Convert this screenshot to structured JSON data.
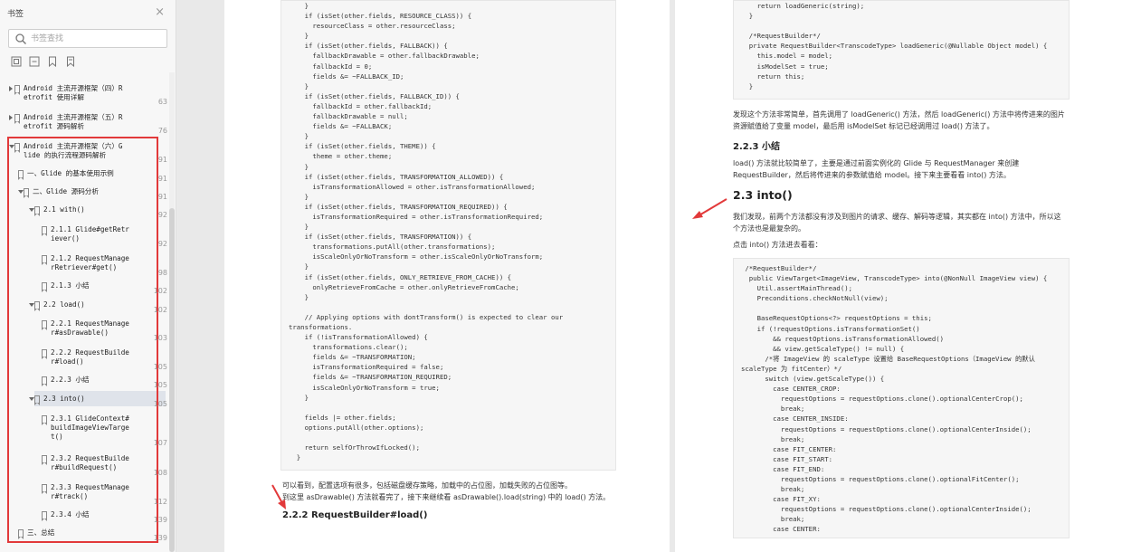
{
  "sidebar": {
    "title": "书签",
    "search_placeholder": "书签查找",
    "items": [
      {
        "label": "Android 主流开源框架（四）R\netrofit 使用详解",
        "page": "63"
      },
      {
        "label": "Android 主流开源框架（五）R\netrofit 源码解析",
        "page": "76"
      },
      {
        "label": "Android 主流开源框架（六）G\nlide 的执行流程源码解析",
        "page": "91"
      },
      {
        "label": "一、Glide 的基本使用示例",
        "page": "91"
      },
      {
        "label": "二、Glide 源码分析",
        "page": "91"
      },
      {
        "label": "2.1 with()",
        "page": "92"
      },
      {
        "label": "2.1.1 Glide#getRetr\niever()",
        "page": "92"
      },
      {
        "label": "2.1.2 RequestManage\nrRetriever#get()",
        "page": "98"
      },
      {
        "label": "2.1.3 小结",
        "page": "102"
      },
      {
        "label": "2.2 load()",
        "page": "102"
      },
      {
        "label": "2.2.1 RequestManage\nr#asDrawable()",
        "page": "103"
      },
      {
        "label": "2.2.2 RequestBuilde\nr#load()",
        "page": "105"
      },
      {
        "label": "2.2.3 小结",
        "page": "105"
      },
      {
        "label": "2.3 into()",
        "page": "105"
      },
      {
        "label": "2.3.1 GlideContext#\nbuildImageViewTarge\nt()",
        "page": "107"
      },
      {
        "label": "2.3.2 RequestBuilde\nr#buildRequest()",
        "page": "108"
      },
      {
        "label": "2.3.3 RequestManage\nr#track()",
        "page": "112"
      },
      {
        "label": "2.3.4 小结",
        "page": "139"
      },
      {
        "label": "三、总结",
        "page": "139"
      }
    ]
  },
  "left_page": {
    "code": "    }\n    if (isSet(other.fields, RESOURCE_CLASS)) {\n      resourceClass = other.resourceClass;\n    }\n    if (isSet(other.fields, FALLBACK)) {\n      fallbackDrawable = other.fallbackDrawable;\n      fallbackId = 0;\n      fields &= ~FALLBACK_ID;\n    }\n    if (isSet(other.fields, FALLBACK_ID)) {\n      fallbackId = other.fallbackId;\n      fallbackDrawable = null;\n      fields &= ~FALLBACK;\n    }\n    if (isSet(other.fields, THEME)) {\n      theme = other.theme;\n    }\n    if (isSet(other.fields, TRANSFORMATION_ALLOWED)) {\n      isTransformationAllowed = other.isTransformationAllowed;\n    }\n    if (isSet(other.fields, TRANSFORMATION_REQUIRED)) {\n      isTransformationRequired = other.isTransformationRequired;\n    }\n    if (isSet(other.fields, TRANSFORMATION)) {\n      transformations.putAll(other.transformations);\n      isScaleOnlyOrNoTransform = other.isScaleOnlyOrNoTransform;\n    }\n    if (isSet(other.fields, ONLY_RETRIEVE_FROM_CACHE)) {\n      onlyRetrieveFromCache = other.onlyRetrieveFromCache;\n    }\n\n    // Applying options with dontTransform() is expected to clear our\ntransformations.\n    if (!isTransformationAllowed) {\n      transformations.clear();\n      fields &= ~TRANSFORMATION;\n      isTransformationRequired = false;\n      fields &= ~TRANSFORMATION_REQUIRED;\n      isScaleOnlyOrNoTransform = true;\n    }\n\n    fields |= other.fields;\n    options.putAll(other.options);\n\n    return selfOrThrowIfLocked();\n  }",
    "para1": "可以看到，配置选项有很多，包括磁盘缓存策略，加载中的占位图，加载失败的占位图等。",
    "para2": "到这里 asDrawable() 方法就看完了，接下来继续看 asDrawable().load(string) 中的 load() 方法。",
    "heading": "2.2.2 RequestBuilder#load()"
  },
  "right_page": {
    "code_top": "    return loadGeneric(string);\n  }\n\n  /*RequestBuilder*/\n  private RequestBuilder<TranscodeType> loadGeneric(@Nullable Object model) {\n    this.model = model;\n    isModelSet = true;\n    return this;\n  }",
    "para1": "发现这个方法非常简单，首先调用了 loadGeneric() 方法，然后 loadGeneric() 方法中将传进来的图片资源赋值给了变量 model，最后用 isModelSet 标记已经调用过 load() 方法了。",
    "h_223": "2.2.3 小结",
    "para2": "load() 方法就比较简单了，主要是通过前面实例化的 Glide 与 RequestManager 来创建 RequestBuilder，然后将传进来的参数赋值给 model。接下来主要看看 into() 方法。",
    "h_23": "2.3 into()",
    "para3": "我们发现，前两个方法都没有涉及到图片的请求、缓存、解码等逻辑，其实都在 into() 方法中，所以这个方法也是最复杂的。",
    "para4": "点击 into() 方法进去看看：",
    "code_main": " /*RequestBuilder*/\n  public ViewTarget<ImageView, TranscodeType> into(@NonNull ImageView view) {\n    Util.assertMainThread();\n    Preconditions.checkNotNull(view);\n\n    BaseRequestOptions<?> requestOptions = this;\n    if (!requestOptions.isTransformationSet()\n        && requestOptions.isTransformationAllowed()\n        && view.getScaleType() != null) {\n      /*将 ImageView 的 scaleType 设置给 BaseRequestOptions（ImageView 的默认\nscaleType 为 fitCenter）*/\n      switch (view.getScaleType()) {\n        case CENTER_CROP:\n          requestOptions = requestOptions.clone().optionalCenterCrop();\n          break;\n        case CENTER_INSIDE:\n          requestOptions = requestOptions.clone().optionalCenterInside();\n          break;\n        case FIT_CENTER:\n        case FIT_START:\n        case FIT_END:\n          requestOptions = requestOptions.clone().optionalFitCenter();\n          break;\n        case FIT_XY:\n          requestOptions = requestOptions.clone().optionalCenterInside();\n          break;\n        case CENTER:"
  },
  "colors": {
    "annotation_red": "#e2393a",
    "selection": "#dfe3ea"
  },
  "icons": {
    "search": "search-icon",
    "close": "close-icon",
    "tools": [
      "expand-all-icon",
      "collapse-all-icon",
      "add-bookmark-icon",
      "bookmark-icon"
    ]
  }
}
